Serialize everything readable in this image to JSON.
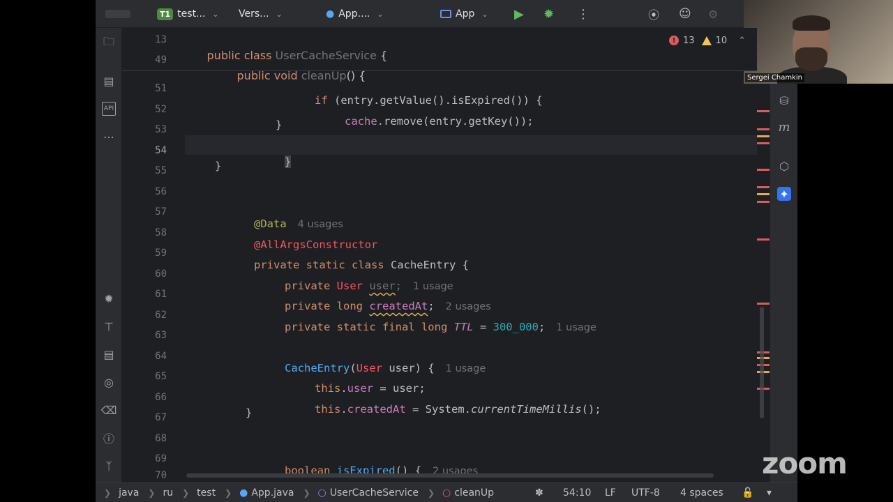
{
  "toolbar": {
    "project_badge": "T1",
    "project_label": "test...",
    "vcs_label": "Vers...",
    "file_label": "App....",
    "run_config_label": "App"
  },
  "inspections": {
    "errors": "13",
    "warnings": "10"
  },
  "gutter_lines": [
    "13",
    "49",
    "51",
    "52",
    "53",
    "54",
    "55",
    "56",
    "57",
    "58",
    "59",
    "60",
    "61",
    "62",
    "63",
    "64",
    "65",
    "66",
    "67",
    "68",
    "69",
    "70"
  ],
  "code": {
    "l13_kw": "public class ",
    "l13_cls": "UserCacheService",
    "l13_rest": " {",
    "l49_kw": "public void ",
    "l49_fn": "cleanUp",
    "l49_rest": "() {",
    "l51_kw": "if ",
    "l51_rest": "(entry.getValue().isExpired()) {",
    "l52_fld": "cache",
    "l52_rest": ".remove(entry.getKey());",
    "l53": "}",
    "l54": "}",
    "l55": "}",
    "l57_ann": "@Data",
    "l57_hint": "4 usages",
    "l58_ann": "@AllArgsConstructor",
    "l59_kw": "private static class ",
    "l59_cls": "CacheEntry",
    "l59_rest": " {",
    "l60_kw": "private ",
    "l60_type": "User",
    "l60_var": "user",
    "l60_semi": ";",
    "l60_hint": "1 usage",
    "l61_kw": "private long ",
    "l61_var": "createdAt",
    "l61_semi": ";",
    "l61_hint": "2 usages",
    "l62_kw": "private static final long ",
    "l62_const": "TTL",
    "l62_eq": " = ",
    "l62_num": "300_000",
    "l62_semi": ";",
    "l62_hint": "1 usage",
    "l64_fn": "CacheEntry",
    "l64_open": "(",
    "l64_type": "User",
    "l64_rest": " user) {",
    "l64_hint": "1 usage",
    "l65_kw": "this",
    "l65_dot": ".",
    "l65_fld": "user",
    "l65_rest": " = user;",
    "l66_kw": "this",
    "l66_dot": ".",
    "l66_fld": "createdAt",
    "l66_eq": " = System.",
    "l66_it": "currentTimeMillis",
    "l66_rest": "();",
    "l67": "}",
    "l69_kw": "boolean ",
    "l69_fn": "isExpired",
    "l69_rest": "() {",
    "l69_hint": "2 usages"
  },
  "statusbar": {
    "crumbs": [
      "java",
      "ru",
      "test",
      "App.java",
      "UserCacheService",
      "cleanUp"
    ],
    "position": "54:10",
    "line_separator": "LF",
    "encoding": "UTF-8",
    "indent": "4 spaces"
  },
  "video": {
    "participant_name": "Sergei Chamkin"
  },
  "zoom_logo": "zoom",
  "colors": {
    "editor_bg": "#1e1f22",
    "keyword": "#cf8e6d",
    "class": "#6fafbd",
    "function": "#56a8f5",
    "field": "#c77dbb",
    "annotation": "#b3ae60",
    "number": "#2aacb8",
    "error": "#f75464"
  },
  "icons": {
    "left_strip": [
      "folder-icon",
      "structure-icon",
      "api-icon",
      "more-icon",
      "debug-icon",
      "build-icon",
      "database-icon",
      "services-icon",
      "terminal-icon",
      "problems-icon",
      "git-icon"
    ],
    "right_strip": [
      "database-icon",
      "maven-icon",
      "gradle-icon",
      "ai-assistant-icon"
    ]
  }
}
